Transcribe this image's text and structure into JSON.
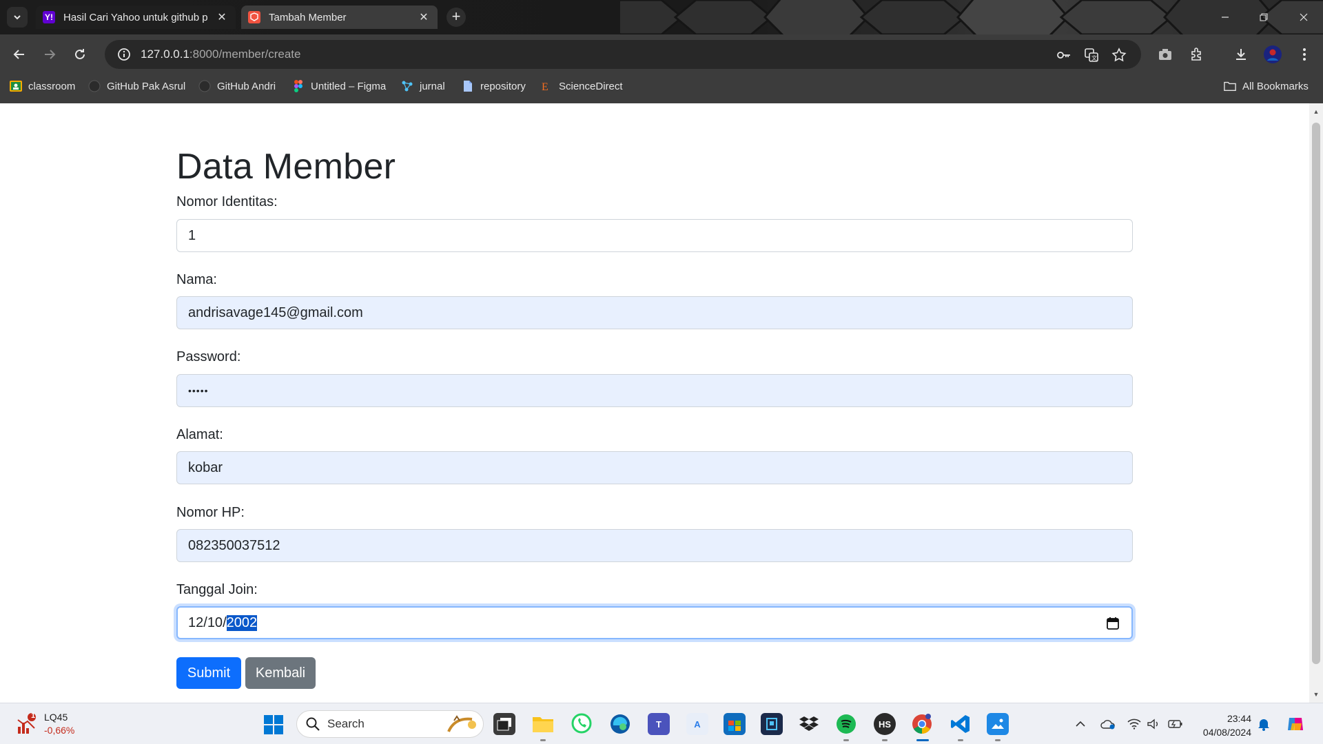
{
  "browser": {
    "tabs": [
      {
        "title": "Hasil Cari Yahoo untuk github p",
        "favicon_icon": "yahoo-icon",
        "active": false
      },
      {
        "title": "Tambah Member",
        "favicon_icon": "laravel-icon",
        "active": true
      }
    ],
    "url_host": "127.0.0.1",
    "url_path": ":8000/member/create",
    "bookmarks": [
      {
        "label": "classroom",
        "icon": "classroom-icon"
      },
      {
        "label": "GitHub Pak Asrul",
        "icon": "github-icon"
      },
      {
        "label": "GitHub Andri",
        "icon": "github-icon"
      },
      {
        "label": "Untitled – Figma",
        "icon": "figma-icon"
      },
      {
        "label": "jurnal",
        "icon": "jurnal-icon"
      },
      {
        "label": "repository",
        "icon": "file-icon"
      },
      {
        "label": "ScienceDirect",
        "icon": "sciencedirect-icon"
      }
    ],
    "all_bookmarks": "All Bookmarks"
  },
  "page": {
    "title": "Data Member",
    "fields": [
      {
        "label": "Nomor Identitas:",
        "value": "1"
      },
      {
        "label": "Nama:",
        "value": "andrisavage145@gmail.com"
      },
      {
        "label": "Password:",
        "value": "•••••"
      },
      {
        "label": "Alamat:",
        "value": "kobar"
      },
      {
        "label": "Nomor HP:",
        "value": "082350037512"
      },
      {
        "label": "Tanggal Join:",
        "value_month": "12",
        "value_day": "10",
        "value_year": "2002",
        "sep": "/"
      }
    ],
    "submit_label": "Submit",
    "back_label": "Kembali"
  },
  "taskbar": {
    "ticker_name": "LQ45",
    "ticker_value": "-0,66%",
    "ticker_badge": "1",
    "search_placeholder": "Search",
    "time": "23:44",
    "date": "04/08/2024"
  },
  "colors": {
    "primary": "#0d6efd",
    "secondary": "#6c757d",
    "autofill_bg": "#e8f0fe",
    "chrome_toolbar": "#3c3c3c"
  }
}
